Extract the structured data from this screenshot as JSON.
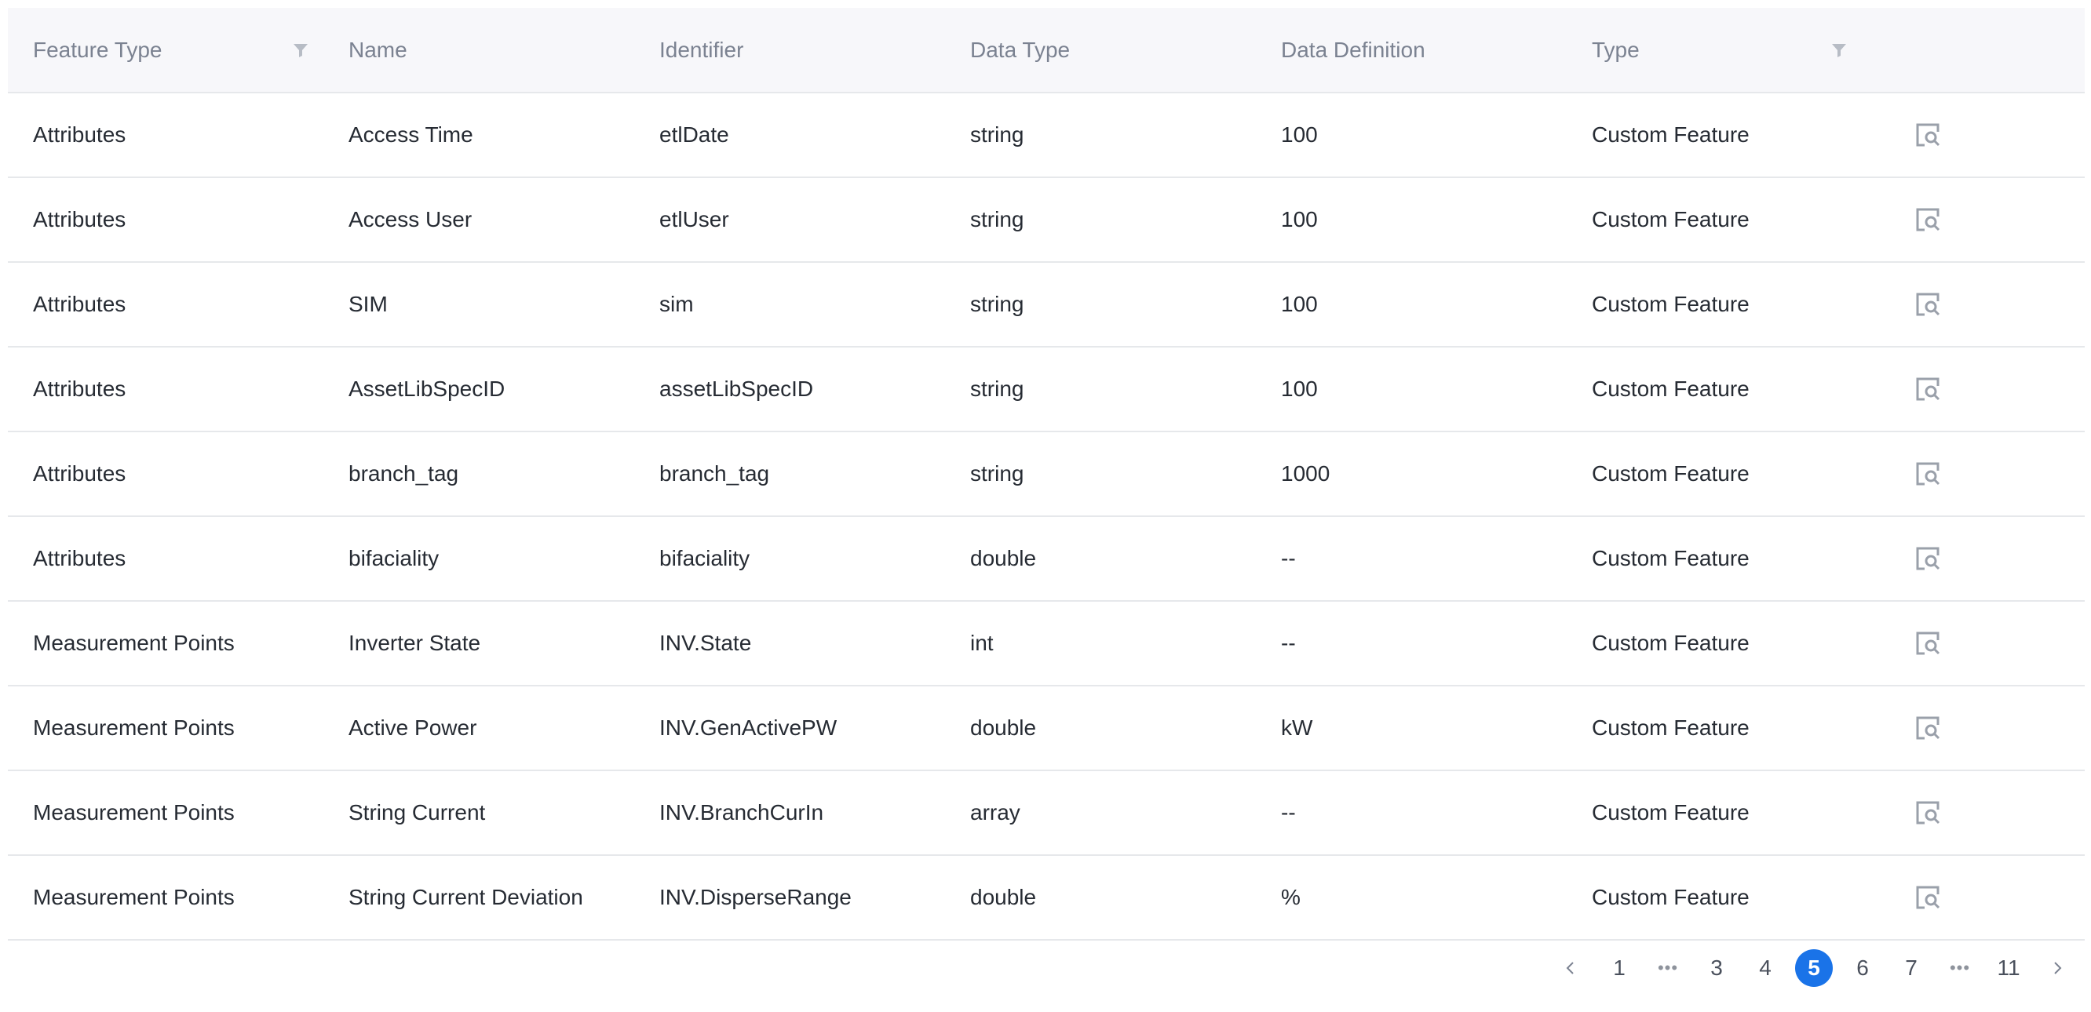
{
  "table": {
    "headers": {
      "feature_type": "Feature Type",
      "name": "Name",
      "identifier": "Identifier",
      "data_type": "Data Type",
      "data_definition": "Data Definition",
      "type": "Type"
    },
    "rows": [
      {
        "feature_type": "Attributes",
        "name": "Access Time",
        "identifier": "etlDate",
        "data_type": "string",
        "data_definition": "100",
        "type": "Custom Feature"
      },
      {
        "feature_type": "Attributes",
        "name": "Access User",
        "identifier": "etlUser",
        "data_type": "string",
        "data_definition": "100",
        "type": "Custom Feature"
      },
      {
        "feature_type": "Attributes",
        "name": "SIM",
        "identifier": "sim",
        "data_type": "string",
        "data_definition": "100",
        "type": "Custom Feature"
      },
      {
        "feature_type": "Attributes",
        "name": "AssetLibSpecID",
        "identifier": "assetLibSpecID",
        "data_type": "string",
        "data_definition": "100",
        "type": "Custom Feature"
      },
      {
        "feature_type": "Attributes",
        "name": "branch_tag",
        "identifier": "branch_tag",
        "data_type": "string",
        "data_definition": "1000",
        "type": "Custom Feature"
      },
      {
        "feature_type": "Attributes",
        "name": "bifaciality",
        "identifier": "bifaciality",
        "data_type": "double",
        "data_definition": "--",
        "type": "Custom Feature"
      },
      {
        "feature_type": "Measurement Points",
        "name": "Inverter State",
        "identifier": "INV.State",
        "data_type": "int",
        "data_definition": "--",
        "type": "Custom Feature"
      },
      {
        "feature_type": "Measurement Points",
        "name": "Active Power",
        "identifier": "INV.GenActivePW",
        "data_type": "double",
        "data_definition": "kW",
        "type": "Custom Feature"
      },
      {
        "feature_type": "Measurement Points",
        "name": "String Current",
        "identifier": "INV.BranchCurIn",
        "data_type": "array",
        "data_definition": "--",
        "type": "Custom Feature"
      },
      {
        "feature_type": "Measurement Points",
        "name": "String Current Deviation",
        "identifier": "INV.DisperseRange",
        "data_type": "double",
        "data_definition": "%",
        "type": "Custom Feature"
      }
    ],
    "row_action_icon": "view-detail-icon",
    "header_filter_icon": "filter-icon"
  },
  "pagination": {
    "items": [
      "1",
      "•••",
      "3",
      "4",
      "5",
      "6",
      "7",
      "•••",
      "11"
    ],
    "current": "5",
    "prev_icon": "chevron-left-icon",
    "next_icon": "chevron-right-icon",
    "accent_color": "#1a73e8"
  }
}
